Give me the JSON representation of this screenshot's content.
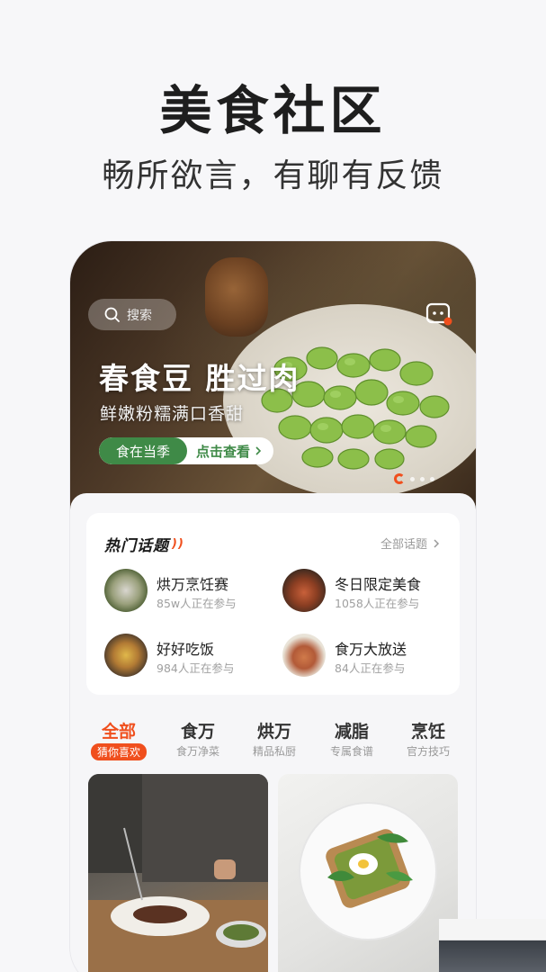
{
  "promo": {
    "title": "美食社区",
    "subtitle": "畅所欲言，有聊有反馈"
  },
  "banner": {
    "search_placeholder": "搜索",
    "headline": "春食豆 胜过肉",
    "sub": "鲜嫩粉糯满口香甜",
    "tag": "食在当季",
    "cta": "点击查看",
    "accent_color": "#3f8a47"
  },
  "topics": {
    "title": "热门话题",
    "all_label": "全部话题",
    "items": [
      {
        "name": "烘万烹饪赛",
        "count": "85w人正在参与"
      },
      {
        "name": "冬日限定美食",
        "count": "1058人正在参与"
      },
      {
        "name": "好好吃饭",
        "count": "984人正在参与"
      },
      {
        "name": "食万大放送",
        "count": "84人正在参与"
      }
    ]
  },
  "tabs": [
    {
      "label": "全部",
      "sub": "猜你喜欢",
      "active": true
    },
    {
      "label": "食万",
      "sub": "食万净菜"
    },
    {
      "label": "烘万",
      "sub": "精品私厨"
    },
    {
      "label": "减脂",
      "sub": "专属食谱"
    },
    {
      "label": "烹饪",
      "sub": "官方技巧"
    }
  ],
  "colors": {
    "brand": "#f04f1d",
    "text": "#1e1e1e",
    "muted": "#999999"
  }
}
